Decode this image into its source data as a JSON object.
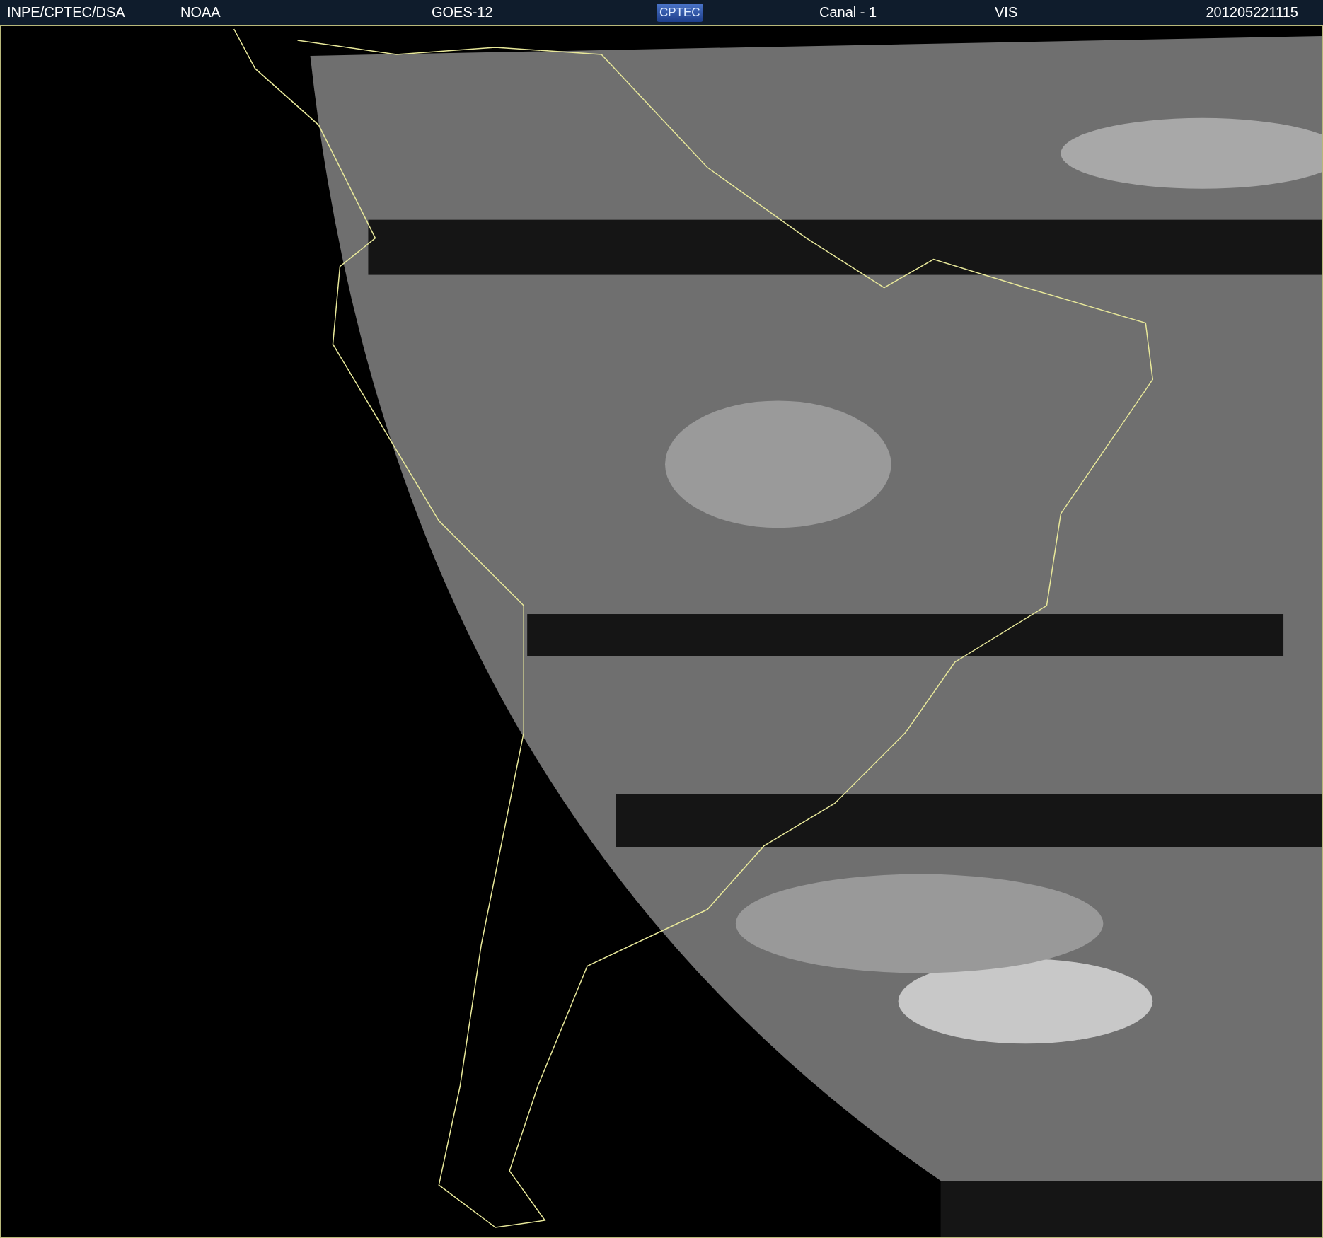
{
  "header": {
    "source": "INPE/CPTEC/DSA",
    "agency": "NOAA",
    "satellite": "GOES-12",
    "logo": "CPTEC",
    "channel": "Canal - 1",
    "band": "VIS",
    "timestamp": "201205221115"
  }
}
